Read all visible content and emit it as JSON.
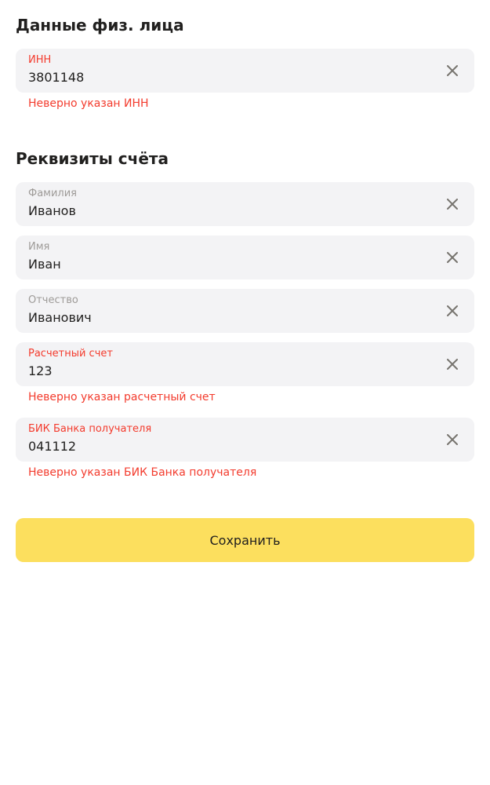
{
  "personal_section": {
    "title": "Данные физ. лица",
    "inn": {
      "label": "ИНН",
      "value": "3801148",
      "error": "Неверно указан ИНН"
    }
  },
  "account_section": {
    "title": "Реквизиты счёта",
    "last_name": {
      "label": "Фамилия",
      "value": "Иванов"
    },
    "first_name": {
      "label": "Имя",
      "value": "Иван"
    },
    "patronymic": {
      "label": "Отчество",
      "value": "Иванович"
    },
    "account_number": {
      "label": "Расчетный счет",
      "value": "123",
      "error": "Неверно указан расчетный счет"
    },
    "bik": {
      "label": "БИК Банка получателя",
      "value": "041112",
      "error": "Неверно указан БИК Банка получателя"
    }
  },
  "icons": {
    "clear": "close-icon"
  },
  "colors": {
    "field_background": "#f3f3f5",
    "error": "#f33b2d",
    "label": "#9e9b98",
    "text": "#21201f",
    "button": "#fcdf5e"
  },
  "save_button": {
    "label": "Сохранить"
  }
}
